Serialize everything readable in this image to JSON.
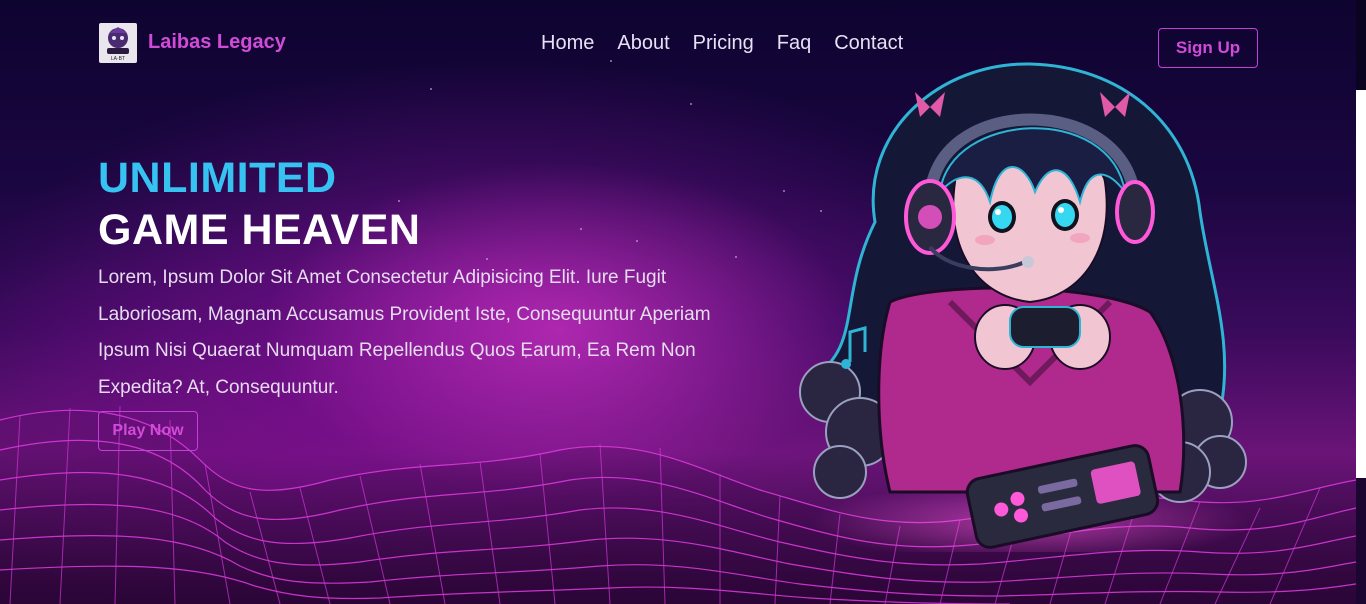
{
  "brand": {
    "name": "Laibas Legacy",
    "logo_text": "LA·BT"
  },
  "nav": {
    "items": [
      "Home",
      "About",
      "Pricing",
      "Faq",
      "Contact"
    ]
  },
  "header": {
    "signup_label": "Sign Up"
  },
  "hero": {
    "title_line1": "UNLIMITED",
    "title_line2": "GAME HEAVEN",
    "description": "Lorem, Ipsum Dolor Sit Amet Consectetur Adipisicing Elit. Iure Fugit Laboriosam, Magnam Accusamus Provident Iste, Consequuntur Aperiam Ipsum Nisi Quaerat Numquam Repellendus Quos Earum, Ea Rem Non Expedita? At, Consequuntur.",
    "cta_label": "Play Now"
  },
  "colors": {
    "accent": "#d24bd8",
    "title_blue": "#37c3f2",
    "background": "#1a0640"
  },
  "icons": [
    "gamer-logo-icon",
    "gamer-girl-illustration"
  ]
}
